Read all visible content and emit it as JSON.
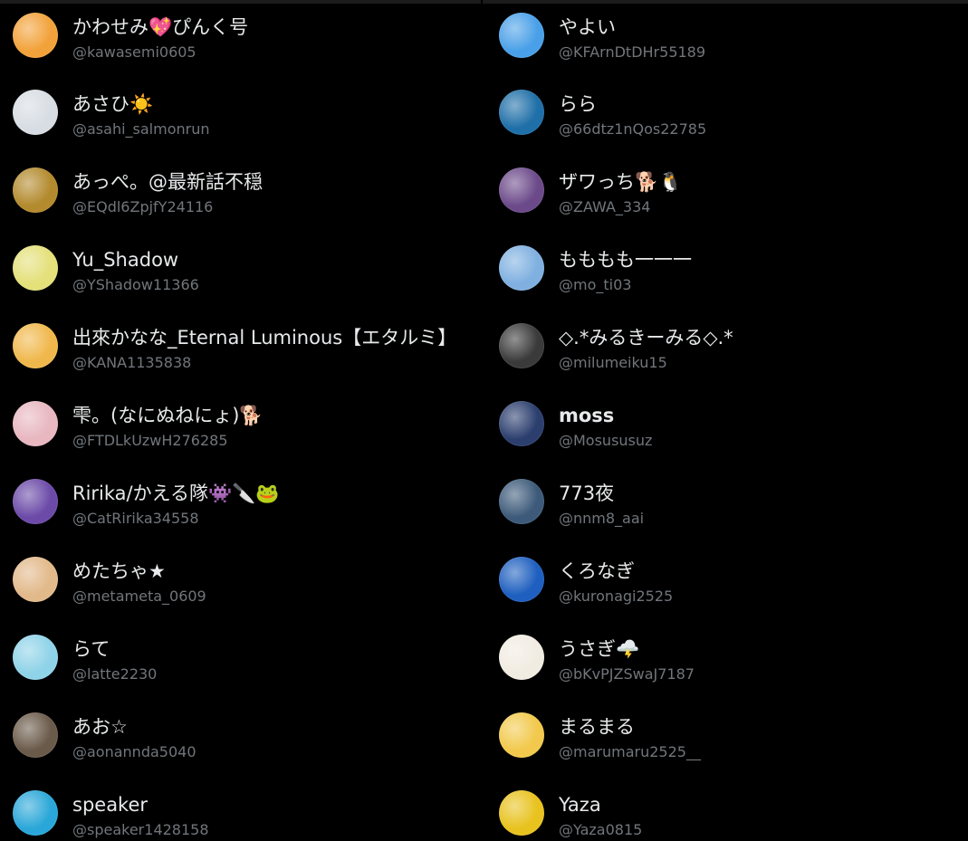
{
  "left_column": [
    {
      "name": "かわせみ💖ぴんく号",
      "handle": "@kawasemi0605",
      "avatar": "character-avatar",
      "color": "#f2a23a"
    },
    {
      "name": "あさひ☀️",
      "handle": "@asahi_salmonrun",
      "avatar": "character-avatar",
      "color": "#d7dde3"
    },
    {
      "name": "あっぺ。@最新話不穏",
      "handle": "@EQdl6ZpjfY24116",
      "avatar": "character-avatar",
      "color": "#b38a2d"
    },
    {
      "name": "Yu_Shadow",
      "handle": "@YShadow11366",
      "avatar": "character-avatar",
      "color": "#e4e07a"
    },
    {
      "name": "出來かなな_Eternal Luminous【エタルミ】",
      "handle": "@KANA1135838",
      "avatar": "character-avatar",
      "color": "#f0b84c"
    },
    {
      "name": "雫。(なにぬねにょ)🐕",
      "handle": "@FTDLkUzwH276285",
      "avatar": "character-avatar",
      "color": "#e8b7c0"
    },
    {
      "name": "Ririka/かえる隊👾🔪🐸",
      "handle": "@CatRirika34558",
      "avatar": "character-avatar",
      "color": "#6b4aa8"
    },
    {
      "name": "めたちゃ★",
      "handle": "@metameta_0609",
      "avatar": "desert-avatar",
      "color": "#e2b98a"
    },
    {
      "name": "らて",
      "handle": "@latte2230",
      "avatar": "character-avatar",
      "color": "#8fd3e8"
    },
    {
      "name": "あお☆",
      "handle": "@aonannda5040",
      "avatar": "character-avatar",
      "color": "#6a5a4a"
    },
    {
      "name": "speaker",
      "handle": "@speaker1428158",
      "avatar": "character-avatar",
      "color": "#2aa7d8"
    }
  ],
  "right_column": [
    {
      "name": "やよい",
      "handle": "@KFArnDtDHr55189",
      "avatar": "sky-avatar",
      "color": "#4aa0e8"
    },
    {
      "name": "らら",
      "handle": "@66dtz1nQos22785",
      "avatar": "sky-avatar",
      "color": "#1f6fa8"
    },
    {
      "name": "ザワっち🐕🐧",
      "handle": "@ZAWA_334",
      "avatar": "character-avatar",
      "color": "#6c4a8a"
    },
    {
      "name": "もももも一一一",
      "handle": "@mo_ti03",
      "avatar": "character-avatar",
      "color": "#7fb0e0"
    },
    {
      "name": "◇.*みるきーみる◇.*",
      "handle": "@milumeiku15",
      "avatar": "character-avatar",
      "color": "#3a3a3a"
    },
    {
      "name": "moss",
      "handle": "@Mosususuz",
      "avatar": "character-avatar",
      "color": "#2b3e6e",
      "bold": true
    },
    {
      "name": "773夜",
      "handle": "@nnm8_aai",
      "avatar": "character-avatar",
      "color": "#3d5a7a"
    },
    {
      "name": "くろなぎ",
      "handle": "@kuronagi2525",
      "avatar": "character-avatar",
      "color": "#1e5fbf"
    },
    {
      "name": "うさぎ🌩️",
      "handle": "@bKvPJZSwaJ7187",
      "avatar": "rabbit-avatar",
      "color": "#f1ece2"
    },
    {
      "name": "まるまる",
      "handle": "@marumaru2525__",
      "avatar": "character-avatar",
      "color": "#f2c94c"
    },
    {
      "name": "Yaza",
      "handle": "@Yaza0815",
      "avatar": "character-avatar",
      "color": "#e8c21e"
    }
  ]
}
